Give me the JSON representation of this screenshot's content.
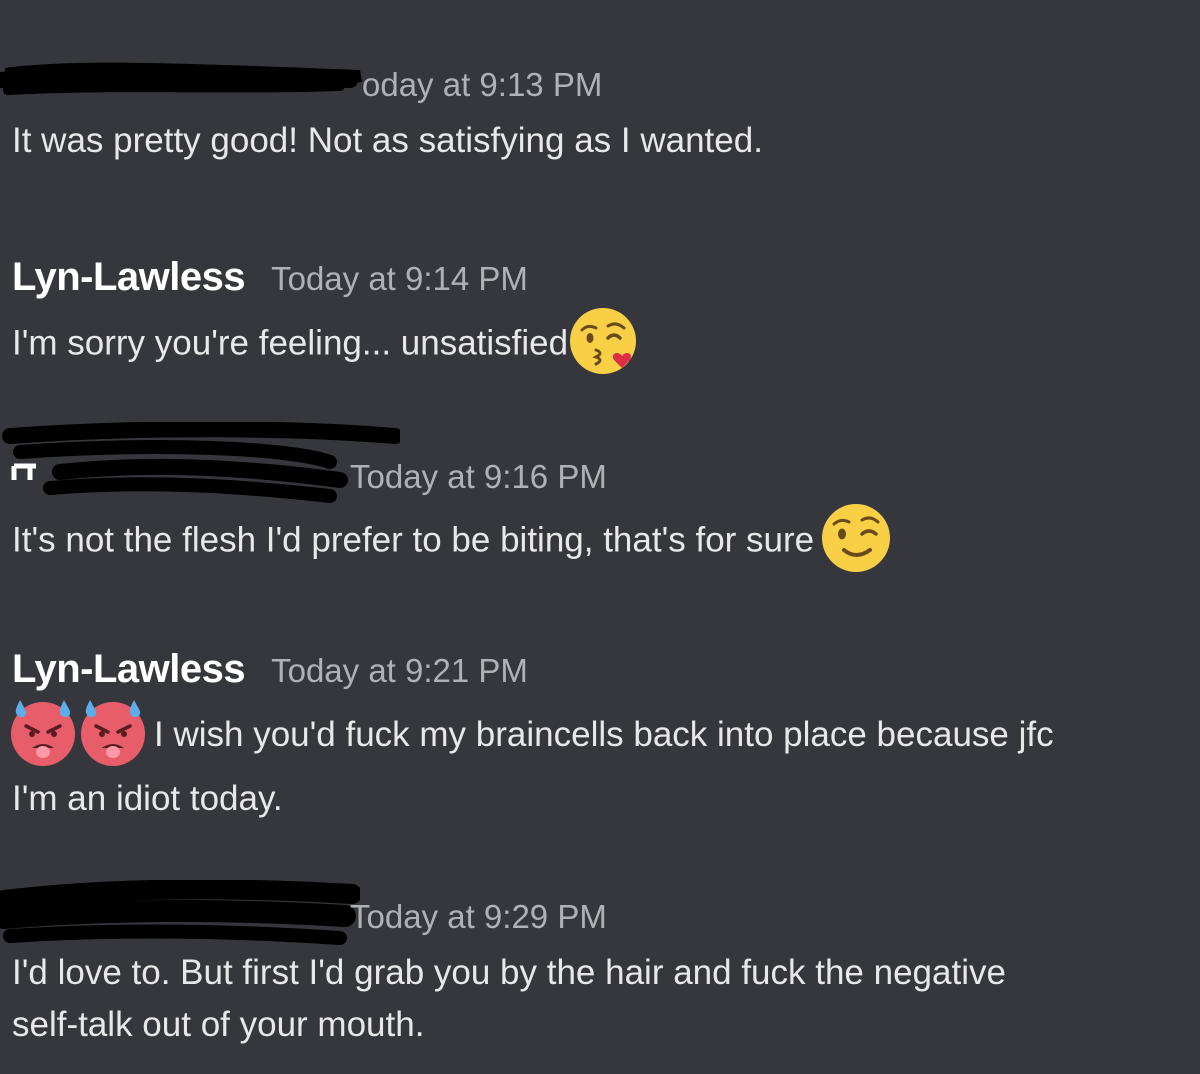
{
  "messages": [
    {
      "author": "",
      "timestamp": "Today at 9:13 PM",
      "timestamp_visible": "oday at 9:13 PM",
      "lines": [
        "It was pretty good! Not as satisfying as I wanted."
      ]
    },
    {
      "author": "Lyn-Lawless",
      "timestamp": "Today at 9:14 PM",
      "lines": [
        "I'm sorry you're feeling... unsatisfied"
      ],
      "emoji": "kissing-face-with-heart-emoji"
    },
    {
      "author": "",
      "timestamp": "Today at 9:16 PM",
      "lines": [
        "It's not the flesh I'd prefer to be biting, that's for sure"
      ],
      "emoji": "winking-face-emoji"
    },
    {
      "author": "Lyn-Lawless",
      "timestamp": "Today at 9:21 PM",
      "lines": [
        "I wish you'd fuck my braincells back into place because jfc",
        "I'm an idiot today."
      ],
      "emoji": "hot-sweating-face-emoji"
    },
    {
      "author": "",
      "timestamp": "Today at 9:29 PM",
      "lines": [
        "I'd love to. But first I'd grab you by the hair and fuck the negative",
        "self-talk out of your mouth."
      ]
    }
  ],
  "colors": {
    "background": "#36373c",
    "username": "#ffffff",
    "timestamp": "#b0b1b6",
    "text": "#e8e8ea",
    "redaction": "#000000"
  }
}
